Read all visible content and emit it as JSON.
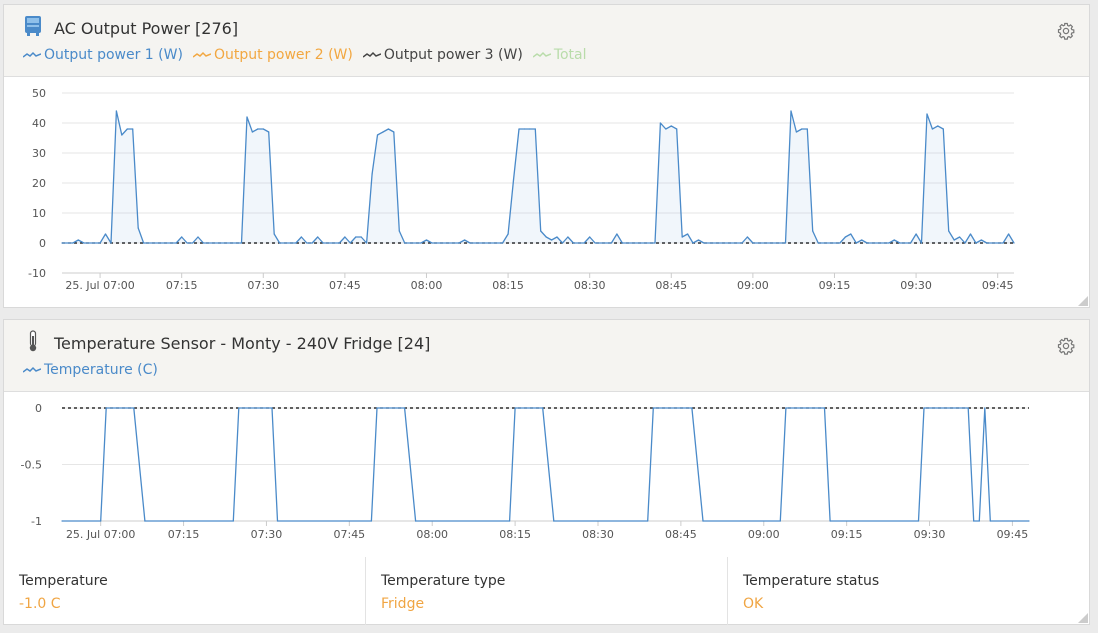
{
  "power_panel": {
    "title": "AC Output Power [276]",
    "icon": "inverter-icon",
    "legend": [
      {
        "label": "Output power 1 (W)",
        "color": "#4a8ac9"
      },
      {
        "label": "Output power 2 (W)",
        "color": "#f2a741"
      },
      {
        "label": "Output power 3 (W)",
        "color": "#444444"
      },
      {
        "label": "Total",
        "color": "#b9dcaa"
      }
    ]
  },
  "temp_panel": {
    "title": "Temperature Sensor - Monty - 240V Fridge [24]",
    "icon": "thermometer-icon",
    "legend": [
      {
        "label": "Temperature (C)",
        "color": "#4a8ac9"
      }
    ],
    "stats": [
      {
        "label": "Temperature",
        "value": "-1.0 C"
      },
      {
        "label": "Temperature type",
        "value": "Fridge"
      },
      {
        "label": "Temperature status",
        "value": "OK"
      }
    ]
  },
  "chart_data": [
    {
      "type": "line",
      "title": "AC Output Power [276]",
      "ylim": [
        -10,
        50
      ],
      "yticks": [
        50,
        40,
        30,
        20,
        10,
        0,
        -10
      ],
      "xlim": [
        "2024-07-25T06:53",
        "2024-07-25T09:48"
      ],
      "xticks": [
        {
          "t": "07:00",
          "label": "25. Jul 07:00"
        },
        {
          "t": "07:15",
          "label": "07:15"
        },
        {
          "t": "07:30",
          "label": "07:30"
        },
        {
          "t": "07:45",
          "label": "07:45"
        },
        {
          "t": "08:00",
          "label": "08:00"
        },
        {
          "t": "08:15",
          "label": "08:15"
        },
        {
          "t": "08:30",
          "label": "08:30"
        },
        {
          "t": "08:45",
          "label": "08:45"
        },
        {
          "t": "09:00",
          "label": "09:00"
        },
        {
          "t": "09:15",
          "label": "09:15"
        },
        {
          "t": "09:30",
          "label": "09:30"
        },
        {
          "t": "09:45",
          "label": "09:45"
        }
      ],
      "reference_line": 0,
      "grid": true,
      "series": [
        {
          "name": "Output power 1 (W)",
          "color": "#4a8ac9",
          "points": [
            [
              "06:53",
              0
            ],
            [
              "06:55",
              0
            ],
            [
              "06:56",
              1
            ],
            [
              "06:57",
              0
            ],
            [
              "06:59",
              0
            ],
            [
              "07:00",
              0
            ],
            [
              "07:01",
              3
            ],
            [
              "07:02",
              0
            ],
            [
              "07:03",
              44
            ],
            [
              "07:04",
              36
            ],
            [
              "07:05",
              38
            ],
            [
              "07:06",
              38
            ],
            [
              "07:07",
              5
            ],
            [
              "07:08",
              0
            ],
            [
              "07:14",
              0
            ],
            [
              "07:15",
              2
            ],
            [
              "07:16",
              0
            ],
            [
              "07:17",
              0
            ],
            [
              "07:18",
              2
            ],
            [
              "07:19",
              0
            ],
            [
              "07:26",
              0
            ],
            [
              "07:27",
              42
            ],
            [
              "07:28",
              37
            ],
            [
              "07:29",
              38
            ],
            [
              "07:30",
              38
            ],
            [
              "07:31",
              37
            ],
            [
              "07:32",
              3
            ],
            [
              "07:33",
              0
            ],
            [
              "07:36",
              0
            ],
            [
              "07:37",
              2
            ],
            [
              "07:38",
              0
            ],
            [
              "07:39",
              0
            ],
            [
              "07:40",
              2
            ],
            [
              "07:41",
              0
            ],
            [
              "07:44",
              0
            ],
            [
              "07:45",
              2
            ],
            [
              "07:46",
              0
            ],
            [
              "07:47",
              2
            ],
            [
              "07:48",
              2
            ],
            [
              "07:49",
              0
            ],
            [
              "07:50",
              23
            ],
            [
              "07:51",
              36
            ],
            [
              "07:52",
              37
            ],
            [
              "07:53",
              38
            ],
            [
              "07:54",
              37
            ],
            [
              "07:55",
              4
            ],
            [
              "07:56",
              0
            ],
            [
              "07:59",
              0
            ],
            [
              "08:00",
              1
            ],
            [
              "08:01",
              0
            ],
            [
              "08:06",
              0
            ],
            [
              "08:07",
              1
            ],
            [
              "08:08",
              0
            ],
            [
              "08:14",
              0
            ],
            [
              "08:15",
              3
            ],
            [
              "08:16",
              21
            ],
            [
              "08:17",
              38
            ],
            [
              "08:18",
              38
            ],
            [
              "08:19",
              38
            ],
            [
              "08:20",
              38
            ],
            [
              "08:21",
              4
            ],
            [
              "08:22",
              2
            ],
            [
              "08:23",
              1
            ],
            [
              "08:24",
              2
            ],
            [
              "08:25",
              0
            ],
            [
              "08:26",
              2
            ],
            [
              "08:27",
              0
            ],
            [
              "08:29",
              0
            ],
            [
              "08:30",
              2
            ],
            [
              "08:31",
              0
            ],
            [
              "08:34",
              0
            ],
            [
              "08:35",
              3
            ],
            [
              "08:36",
              0
            ],
            [
              "08:42",
              0
            ],
            [
              "08:43",
              40
            ],
            [
              "08:44",
              38
            ],
            [
              "08:45",
              39
            ],
            [
              "08:46",
              38
            ],
            [
              "08:47",
              2
            ],
            [
              "08:48",
              3
            ],
            [
              "08:49",
              0
            ],
            [
              "08:50",
              1
            ],
            [
              "08:51",
              0
            ],
            [
              "08:58",
              0
            ],
            [
              "08:59",
              2
            ],
            [
              "09:00",
              0
            ],
            [
              "09:06",
              0
            ],
            [
              "09:07",
              44
            ],
            [
              "09:08",
              37
            ],
            [
              "09:09",
              38
            ],
            [
              "09:10",
              38
            ],
            [
              "09:11",
              4
            ],
            [
              "09:12",
              0
            ],
            [
              "09:16",
              0
            ],
            [
              "09:17",
              2
            ],
            [
              "09:18",
              3
            ],
            [
              "09:19",
              0
            ],
            [
              "09:20",
              1
            ],
            [
              "09:21",
              0
            ],
            [
              "09:25",
              0
            ],
            [
              "09:26",
              1
            ],
            [
              "09:27",
              0
            ],
            [
              "09:29",
              0
            ],
            [
              "09:30",
              3
            ],
            [
              "09:31",
              0
            ],
            [
              "09:32",
              43
            ],
            [
              "09:33",
              38
            ],
            [
              "09:34",
              39
            ],
            [
              "09:35",
              38
            ],
            [
              "09:36",
              4
            ],
            [
              "09:37",
              1
            ],
            [
              "09:38",
              2
            ],
            [
              "09:39",
              0
            ],
            [
              "09:40",
              3
            ],
            [
              "09:41",
              0
            ],
            [
              "09:42",
              1
            ],
            [
              "09:43",
              0
            ],
            [
              "09:46",
              0
            ],
            [
              "09:47",
              3
            ],
            [
              "09:48",
              0
            ]
          ]
        }
      ]
    },
    {
      "type": "line",
      "title": "Temperature Sensor - Monty - 240V Fridge [24]",
      "ylim": [
        -1,
        0
      ],
      "yticks": [
        0,
        -0.5,
        -1
      ],
      "ytick_labels": [
        "0",
        "-0.5",
        "-1"
      ],
      "xlim": [
        "2024-07-25T06:53",
        "2024-07-25T09:48"
      ],
      "xticks": [
        {
          "t": "07:00",
          "label": "25. Jul 07:00"
        },
        {
          "t": "07:15",
          "label": "07:15"
        },
        {
          "t": "07:30",
          "label": "07:30"
        },
        {
          "t": "07:45",
          "label": "07:45"
        },
        {
          "t": "08:00",
          "label": "08:00"
        },
        {
          "t": "08:15",
          "label": "08:15"
        },
        {
          "t": "08:30",
          "label": "08:30"
        },
        {
          "t": "08:45",
          "label": "08:45"
        },
        {
          "t": "09:00",
          "label": "09:00"
        },
        {
          "t": "09:15",
          "label": "09:15"
        },
        {
          "t": "09:30",
          "label": "09:30"
        },
        {
          "t": "09:45",
          "label": "09:45"
        }
      ],
      "reference_line": 0,
      "grid": true,
      "series": [
        {
          "name": "Temperature (C)",
          "color": "#4a8ac9",
          "points": [
            [
              "06:53",
              -1
            ],
            [
              "07:00",
              -1
            ],
            [
              "07:01",
              0
            ],
            [
              "07:06",
              0
            ],
            [
              "07:08",
              -1
            ],
            [
              "07:24",
              -1
            ],
            [
              "07:25",
              0
            ],
            [
              "07:31",
              0
            ],
            [
              "07:32",
              -1
            ],
            [
              "07:49",
              -1
            ],
            [
              "07:50",
              0
            ],
            [
              "07:55",
              0
            ],
            [
              "07:57",
              -1
            ],
            [
              "08:14",
              -1
            ],
            [
              "08:15",
              0
            ],
            [
              "08:20",
              0
            ],
            [
              "08:22",
              -1
            ],
            [
              "08:39",
              -1
            ],
            [
              "08:40",
              0
            ],
            [
              "08:47",
              0
            ],
            [
              "08:49",
              -1
            ],
            [
              "09:03",
              -1
            ],
            [
              "09:04",
              0
            ],
            [
              "09:11",
              0
            ],
            [
              "09:12",
              -1
            ],
            [
              "09:28",
              -1
            ],
            [
              "09:29",
              0
            ],
            [
              "09:37",
              0
            ],
            [
              "09:38",
              -1
            ],
            [
              "09:39",
              -1
            ],
            [
              "09:40",
              0
            ],
            [
              "09:41",
              -1
            ],
            [
              "09:48",
              -1
            ]
          ]
        }
      ]
    }
  ]
}
